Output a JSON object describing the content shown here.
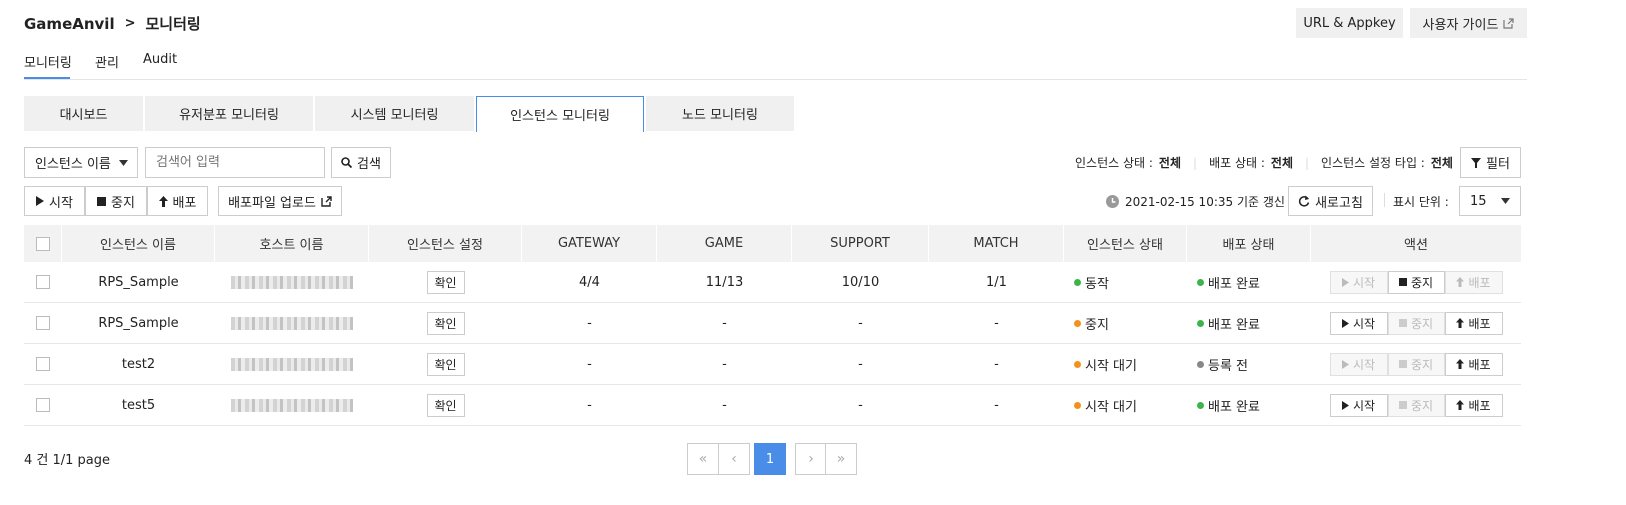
{
  "breadcrumb": {
    "root": "GameAnvil",
    "separator": ">",
    "current": "모니터링"
  },
  "header_buttons": {
    "url_appkey": "URL & Appkey",
    "user_guide": "사용자 가이드"
  },
  "main_tabs": [
    "모니터링",
    "관리",
    "Audit"
  ],
  "sub_tabs": [
    "대시보드",
    "유저분포 모니터링",
    "시스템 모니터링",
    "인스턴스 모니터링",
    "노드 모니터링"
  ],
  "search": {
    "select_value": "인스턴스 이름",
    "placeholder": "검색어 입력",
    "button": "검색"
  },
  "filters": {
    "instance_state_label": "인스턴스 상태 :",
    "instance_state_value": "전체",
    "deploy_state_label": "배포 상태 :",
    "deploy_state_value": "전체",
    "setting_type_label": "인스턴스 설정 타입 :",
    "setting_type_value": "전체",
    "filter_button": "필터"
  },
  "actions": {
    "start": "시작",
    "stop": "중지",
    "deploy": "배포",
    "upload": "배포파일 업로드"
  },
  "refresh": {
    "timestamp": "2021-02-15 10:35 기준 갱신",
    "button": "새로고침",
    "unit_label": "표시 단위 :",
    "unit_value": "15"
  },
  "table": {
    "headers": [
      "인스턴스 이름",
      "호스트 이름",
      "인스턴스 설정",
      "GATEWAY",
      "GAME",
      "SUPPORT",
      "MATCH",
      "인스턴스 상태",
      "배포 상태",
      "액션"
    ],
    "rows": [
      {
        "name": "RPS_Sample",
        "setting": "확인",
        "gateway": "4/4",
        "game": "11/13",
        "support": "10/10",
        "match": "1/1",
        "state": "동작",
        "deploy": "배포 완료"
      },
      {
        "name": "RPS_Sample",
        "setting": "확인",
        "gateway": "-",
        "game": "-",
        "support": "-",
        "match": "-",
        "state": "중지",
        "deploy": "배포 완료"
      },
      {
        "name": "test2",
        "setting": "확인",
        "gateway": "-",
        "game": "-",
        "support": "-",
        "match": "-",
        "state": "시작 대기",
        "deploy": "등록 전"
      },
      {
        "name": "test5",
        "setting": "확인",
        "gateway": "-",
        "game": "-",
        "support": "-",
        "match": "-",
        "state": "시작 대기",
        "deploy": "배포 완료"
      }
    ]
  },
  "footer": {
    "count": "4 건 1/1 page",
    "current_page": "1"
  },
  "colors": {
    "accent": "#4a8de8",
    "green": "#3cb44b",
    "orange": "#f5901e",
    "grey": "#888888"
  }
}
